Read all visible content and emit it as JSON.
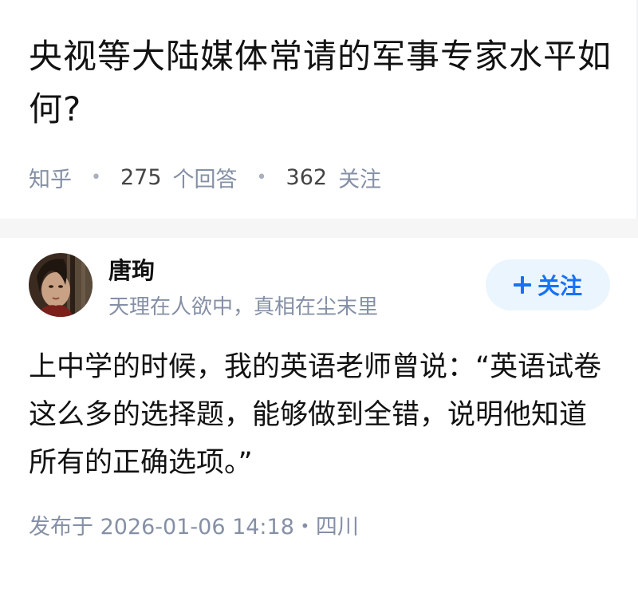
{
  "question": {
    "title": "央视等大陆媒体常请的军事专家水平如何?",
    "source": "知乎",
    "answers_count": "275",
    "answers_label": "个回答",
    "followers_count": "362",
    "followers_label": "关注"
  },
  "answer": {
    "author_name": "唐珣",
    "author_bio": "天理在人欲中，真相在尘末里",
    "follow_button": "关注",
    "content": "上中学的时候，我的英语老师曾说：“英语试卷这么多的选择题，能够做到全错，说明他知道所有的正确选项。”",
    "published": "发布于 2026-01-06 14:18・四川"
  },
  "colors": {
    "accent": "#1772f6",
    "accent_bg": "#ebf5fd",
    "text_primary": "#121212",
    "text_secondary": "#8590a6",
    "separator": "#f6f6f6"
  }
}
